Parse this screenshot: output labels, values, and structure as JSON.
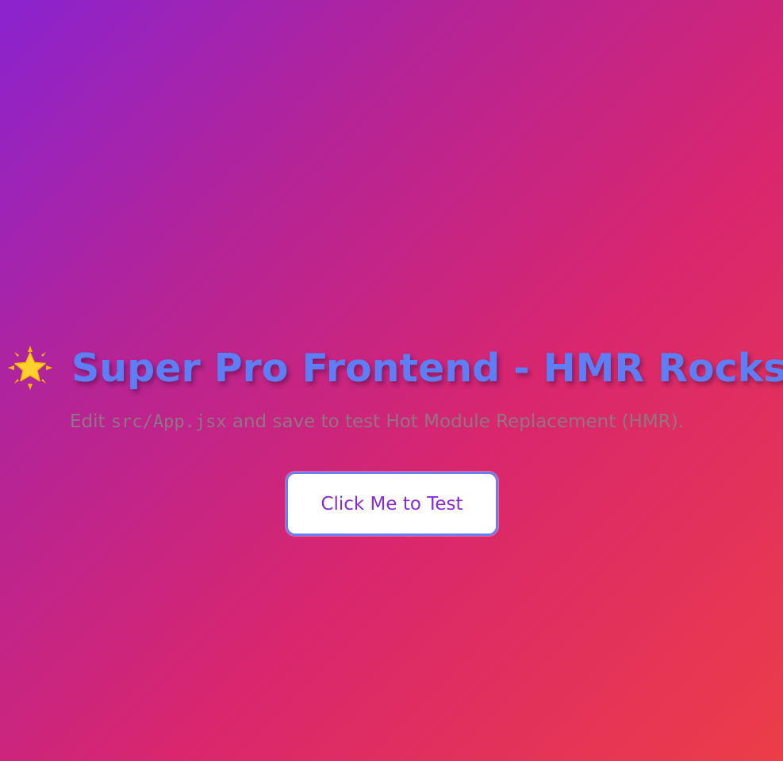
{
  "header": {
    "title_icon": "star-icon",
    "title": "Super Pro Frontend - HMR Rocks!"
  },
  "subtitle": {
    "before": "Edit ",
    "code": "src/App.jsx",
    "after": " and save to test Hot Module Replacement (HMR)."
  },
  "actions": {
    "test_button_label": "Click Me to Test"
  },
  "colors": {
    "title": "#5d7ef4",
    "button_text": "#8a2bd6",
    "button_border": "#6b7ff0",
    "gradient_start": "#8a23cf",
    "gradient_end": "#ec3d48"
  }
}
